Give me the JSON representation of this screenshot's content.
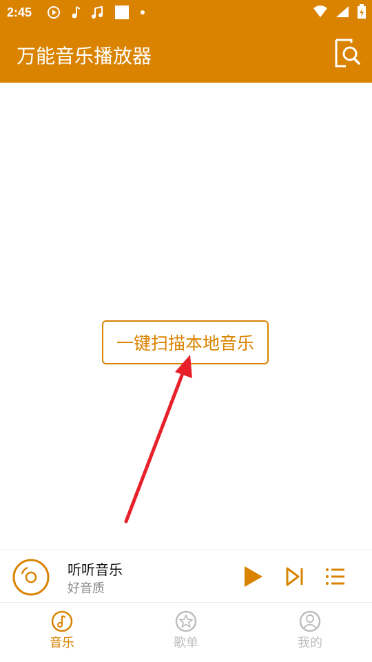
{
  "status": {
    "time": "2:45",
    "left_icons": [
      "play-circle-icon",
      "music-note-icon",
      "music-notes-icon",
      "square-icon",
      "dot-icon"
    ],
    "right_icons": [
      "wifi-icon",
      "signal-icon",
      "battery-icon"
    ]
  },
  "appbar": {
    "title": "万能音乐播放器"
  },
  "main": {
    "scan_button_label": "一键扫描本地音乐"
  },
  "player": {
    "title": "听听音乐",
    "subtitle": "好音质"
  },
  "nav": {
    "items": [
      {
        "label": "音乐",
        "active": true
      },
      {
        "label": "歌单",
        "active": false
      },
      {
        "label": "我的",
        "active": false
      }
    ]
  },
  "colors": {
    "accent": "#D98300",
    "arrow": "#E8202A",
    "inactive": "#BDBDBD"
  }
}
